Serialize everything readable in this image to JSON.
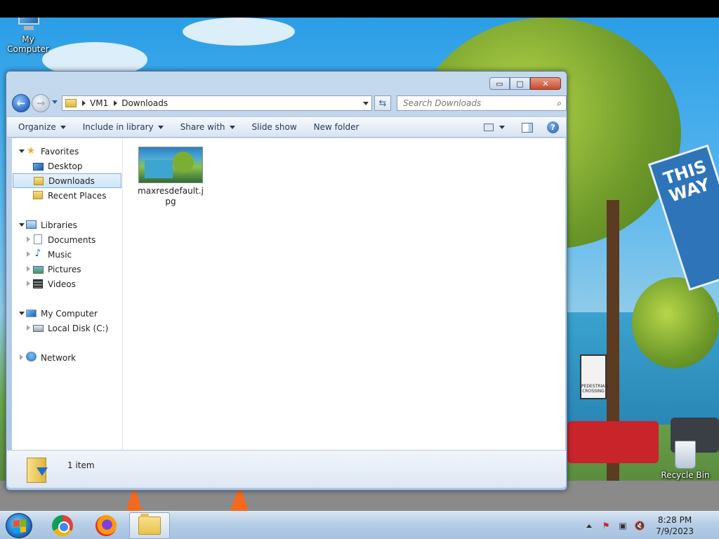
{
  "desktop": {
    "icons": [
      {
        "label": "My Computer"
      },
      {
        "label": "Recycle Bin"
      }
    ],
    "wallpaper_sign_text": "THIS WAY",
    "wallpaper_small_sign": "PEDESTRIAN CROSSING"
  },
  "window": {
    "controls": {
      "minimize": "▭",
      "maximize": "□",
      "close": "✕"
    },
    "address": {
      "crumbs": [
        "VM1",
        "Downloads"
      ]
    },
    "search": {
      "placeholder": "Search Downloads"
    },
    "toolbar": {
      "organize": "Organize",
      "include_in_library": "Include in library",
      "share_with": "Share with",
      "slide_show": "Slide show",
      "new_folder": "New folder"
    },
    "nav": {
      "favorites": "Favorites",
      "desktop": "Desktop",
      "downloads": "Downloads",
      "recent_places": "Recent Places",
      "libraries": "Libraries",
      "documents": "Documents",
      "music": "Music",
      "pictures": "Pictures",
      "videos": "Videos",
      "my_computer": "My Computer",
      "local_disk": "Local Disk (C:)",
      "network": "Network"
    },
    "files": [
      {
        "name": "maxresdefault.jpg"
      }
    ],
    "details": {
      "count": "1 item"
    }
  },
  "taskbar": {
    "apps": [
      "start-button",
      "chrome",
      "firefox",
      "windows-explorer"
    ],
    "clock": {
      "time": "8:28 PM",
      "date": "7/9/2023"
    }
  },
  "colors": {
    "accent": "#2d6bc6",
    "selection": "#cde6f7",
    "taskbar": "#b6cde6"
  }
}
